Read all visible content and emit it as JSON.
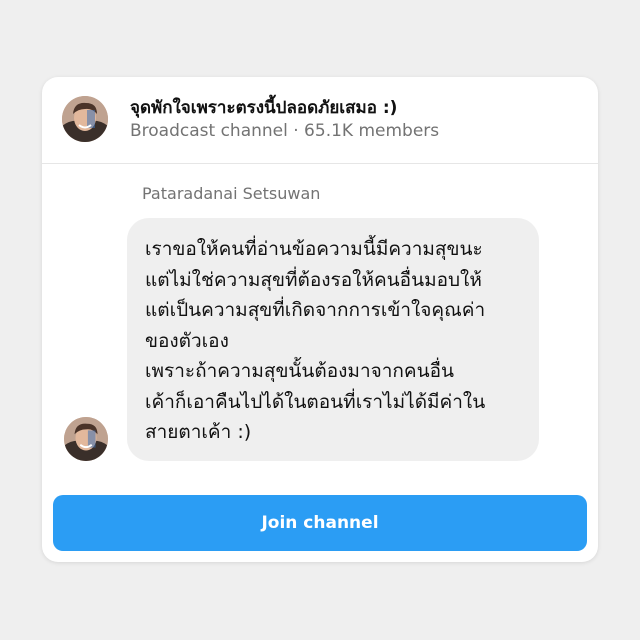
{
  "channel": {
    "title": "จุดพักใจเพราะตรงนี้ปลอดภัยเสมอ :)",
    "subtitle": "Broadcast channel · 65.1K members",
    "avatar_icon": "profile-photo"
  },
  "message": {
    "sender": "Pataradanai Setsuwan",
    "lines": [
      "เราขอให้คนที่อ่านข้อความนี้มีความสุขนะ",
      "แต่ไม่ใช่ความสุขที่ต้องรอให้คนอื่นมอบให้",
      "แต่เป็นความสุขที่เกิดจากการเข้าใจคุณค่า",
      "ของตัวเอง",
      "เพราะถ้าความสุขนั้นต้องมาจากคนอื่น",
      "เค้าก็เอาคืนไปได้ในตอนที่เราไม่ได้มีค่าใน",
      "สายตาเค้า :)"
    ]
  },
  "actions": {
    "join_label": "Join channel"
  },
  "colors": {
    "background": "#efefef",
    "card": "#ffffff",
    "bubble": "#efefef",
    "accent": "#2b9df4",
    "secondary_text": "#737373"
  }
}
